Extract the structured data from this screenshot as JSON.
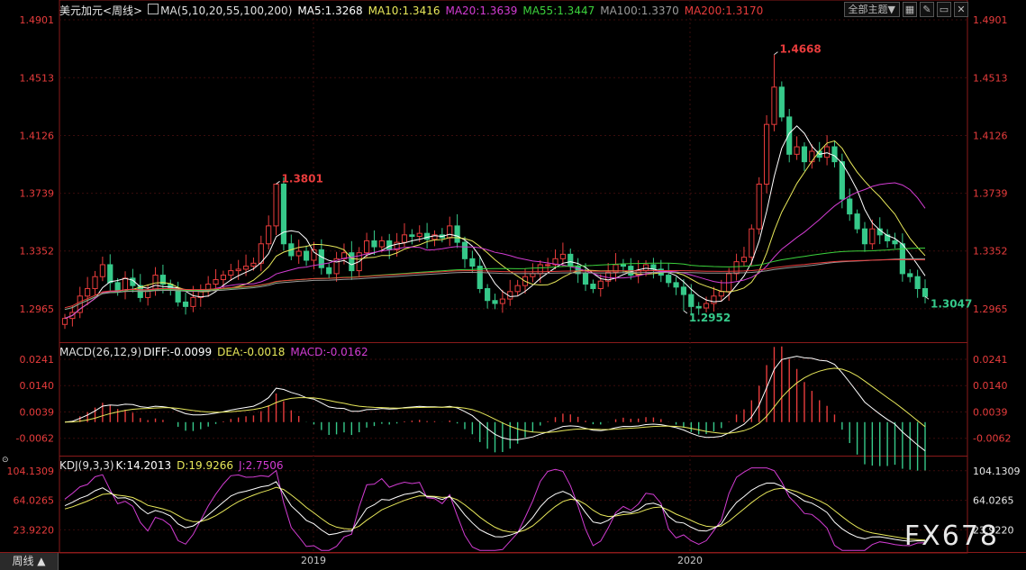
{
  "instrument": {
    "title": "美元加元<周线>",
    "ma_label": "MA(5,10,20,55,100,200)",
    "ma_values": [
      {
        "label": "MA5:1.3268",
        "color": "#ffffff"
      },
      {
        "label": "MA10:1.3416",
        "color": "#e8e85a"
      },
      {
        "label": "MA20:1.3639",
        "color": "#d23cd2"
      },
      {
        "label": "MA55:1.3447",
        "color": "#3cd23c"
      },
      {
        "label": "MA100:1.3370",
        "color": "#9a9a9a"
      },
      {
        "label": "MA200:1.3170",
        "color": "#e83c3c"
      }
    ]
  },
  "toolbar": {
    "theme_button": "全部主题▼",
    "icons": [
      "grid-icon",
      "edit-icon",
      "expand-icon",
      "close-icon"
    ]
  },
  "macd": {
    "label": "MACD(26,12,9)",
    "diff": "DIFF:-0.0099",
    "dea": "DEA:-0.0018",
    "macd": "MACD:-0.0162"
  },
  "kdj": {
    "label": "KDJ(9,3,3)",
    "k": "K:14.2013",
    "d": "D:19.9266",
    "j": "J:2.7506"
  },
  "bottom_tab": "周线 ▲",
  "watermark": "FX678",
  "colors": {
    "up": "#e83c3c",
    "down": "#36c98a",
    "k": "#ffffff",
    "d": "#e8e85a",
    "j": "#d23cd2",
    "diff": "#ffffff",
    "dea": "#e8e85a"
  },
  "chart_data": [
    {
      "type": "candlestick",
      "title": "美元加元<周线>",
      "y_ticks": [
        "1.4901",
        "1.4513",
        "1.4126",
        "1.3739",
        "1.3352",
        "1.2965"
      ],
      "y_tick_values": [
        1.4901,
        1.4513,
        1.4126,
        1.3739,
        1.3352,
        1.2965
      ],
      "x_labels": [
        "2019",
        "2020"
      ],
      "annotations": [
        {
          "text": "1.3801",
          "value": 1.3801,
          "kind": "high"
        },
        {
          "text": "1.2952",
          "value": 1.2952,
          "kind": "low"
        },
        {
          "text": "1.4668",
          "value": 1.4668,
          "kind": "high"
        },
        {
          "text": "1.3047",
          "value": 1.3047,
          "kind": "last"
        }
      ],
      "close": [
        1.29,
        1.294,
        1.305,
        1.31,
        1.318,
        1.326,
        1.314,
        1.309,
        1.317,
        1.312,
        1.304,
        1.309,
        1.319,
        1.313,
        1.31,
        1.301,
        1.298,
        1.304,
        1.309,
        1.313,
        1.316,
        1.319,
        1.322,
        1.323,
        1.325,
        1.327,
        1.34,
        1.352,
        1.38,
        1.34,
        1.332,
        1.335,
        1.329,
        1.336,
        1.324,
        1.32,
        1.33,
        1.334,
        1.322,
        1.334,
        1.342,
        1.338,
        1.342,
        1.336,
        1.341,
        1.346,
        1.345,
        1.347,
        1.343,
        1.346,
        1.344,
        1.352,
        1.341,
        1.33,
        1.325,
        1.31,
        1.302,
        1.3,
        1.303,
        1.308,
        1.312,
        1.318,
        1.32,
        1.326,
        1.326,
        1.33,
        1.333,
        1.325,
        1.32,
        1.313,
        1.31,
        1.315,
        1.321,
        1.326,
        1.325,
        1.319,
        1.322,
        1.326,
        1.323,
        1.319,
        1.314,
        1.311,
        1.306,
        1.298,
        1.297,
        1.3,
        1.305,
        1.308,
        1.32,
        1.328,
        1.331,
        1.35,
        1.38,
        1.42,
        1.445,
        1.425,
        1.4,
        1.405,
        1.395,
        1.402,
        1.398,
        1.405,
        1.395,
        1.37,
        1.36,
        1.35,
        1.34,
        1.35,
        1.346,
        1.342,
        1.34,
        1.32,
        1.318,
        1.31,
        1.3047
      ],
      "series": [
        {
          "name": "MA5",
          "value": 1.3268
        },
        {
          "name": "MA10",
          "value": 1.3416
        },
        {
          "name": "MA20",
          "value": 1.3639
        },
        {
          "name": "MA55",
          "value": 1.3447
        },
        {
          "name": "MA100",
          "value": 1.337
        },
        {
          "name": "MA200",
          "value": 1.317
        }
      ]
    },
    {
      "type": "line",
      "title": "MACD(26,12,9)",
      "y_ticks": [
        "0.0241",
        "0.0140",
        "0.0039",
        "-0.0062"
      ],
      "y_tick_values": [
        0.0241,
        0.014,
        0.0039,
        -0.0062
      ],
      "last": {
        "DIFF": -0.0099,
        "DEA": -0.0018,
        "MACD": -0.0162
      }
    },
    {
      "type": "line",
      "title": "KDJ(9,3,3)",
      "y_ticks": [
        "104.1309",
        "64.0265",
        "23.9220"
      ],
      "y_tick_values": [
        104.1309,
        64.0265,
        23.922
      ],
      "last": {
        "K": 14.2013,
        "D": 19.9266,
        "J": 2.7506
      }
    }
  ]
}
